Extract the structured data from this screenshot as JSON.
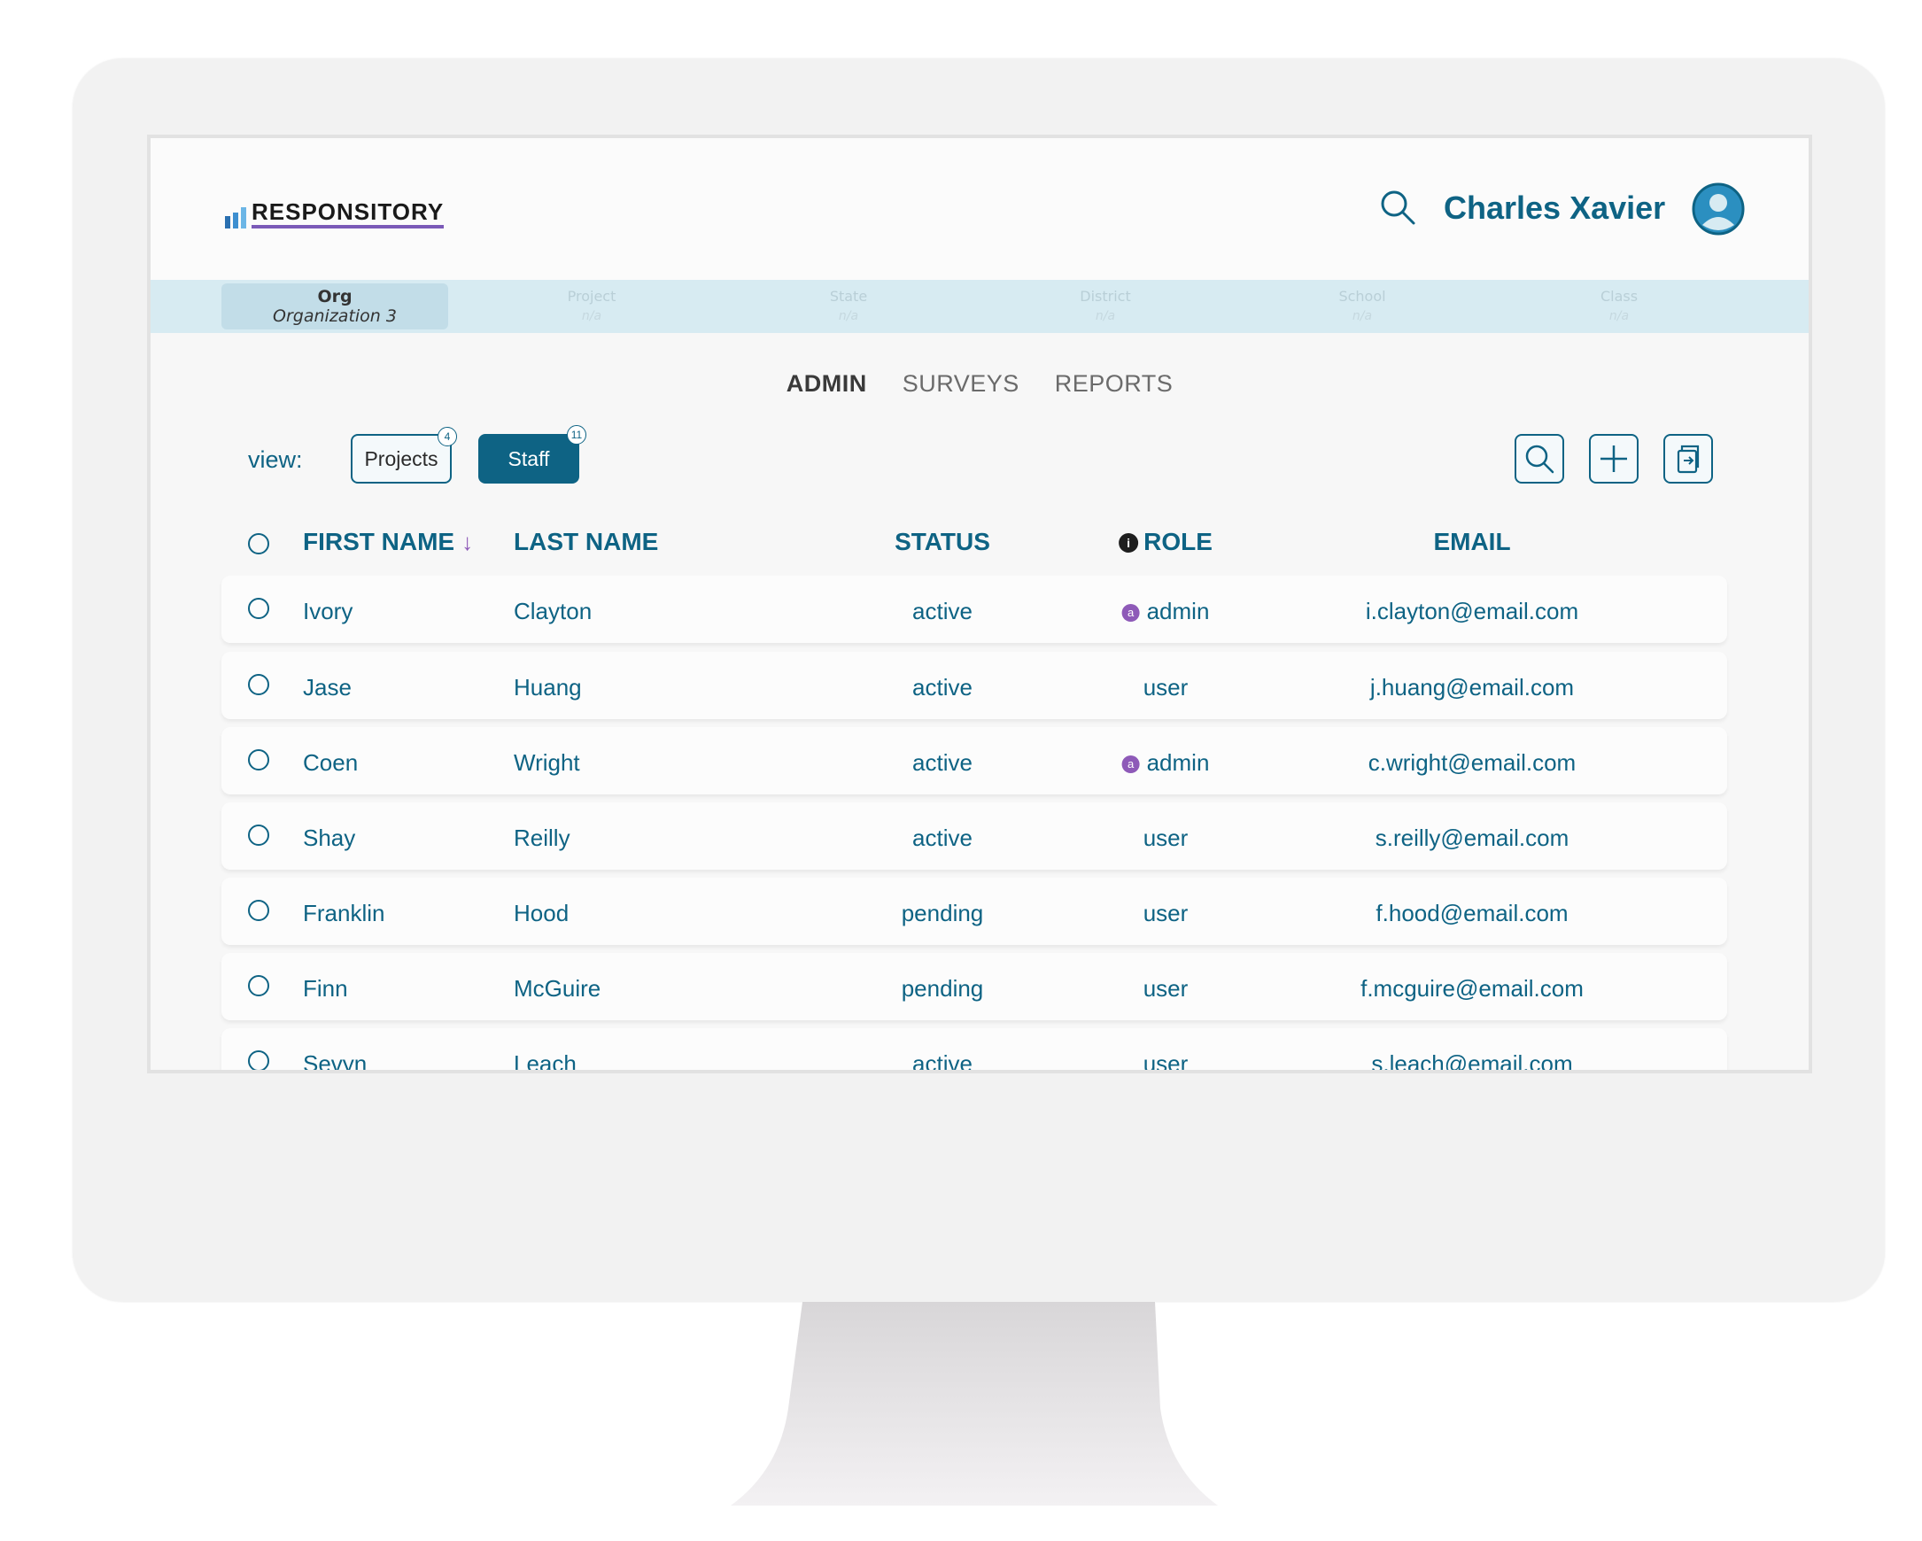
{
  "header": {
    "logo_text": "RESPONSITORY",
    "user_name": "Charles Xavier"
  },
  "breadcrumb": [
    {
      "label": "Org",
      "value": "Organization 3"
    },
    {
      "label": "Project",
      "value": "n/a"
    },
    {
      "label": "State",
      "value": "n/a"
    },
    {
      "label": "District",
      "value": "n/a"
    },
    {
      "label": "School",
      "value": "n/a"
    },
    {
      "label": "Class",
      "value": "n/a"
    }
  ],
  "nav": {
    "tabs": [
      "ADMIN",
      "SURVEYS",
      "REPORTS"
    ],
    "active": "ADMIN"
  },
  "view": {
    "label": "view:",
    "projects_label": "Projects",
    "projects_count": "4",
    "staff_label": "Staff",
    "staff_count": "11"
  },
  "table": {
    "columns": {
      "first_name": "FIRST NAME",
      "sort_arrow": "↓",
      "last_name": "LAST NAME",
      "status": "STATUS",
      "role": "ROLE",
      "role_info": "i",
      "email": "EMAIL"
    },
    "admin_badge": "a",
    "rows": [
      {
        "first": "Ivory",
        "last": "Clayton",
        "status": "active",
        "role": "admin",
        "email": "i.clayton@email.com"
      },
      {
        "first": "Jase",
        "last": "Huang",
        "status": "active",
        "role": "user",
        "email": "j.huang@email.com"
      },
      {
        "first": "Coen",
        "last": "Wright",
        "status": "active",
        "role": "admin",
        "email": "c.wright@email.com"
      },
      {
        "first": "Shay",
        "last": "Reilly",
        "status": "active",
        "role": "user",
        "email": "s.reilly@email.com"
      },
      {
        "first": "Franklin",
        "last": "Hood",
        "status": "pending",
        "role": "user",
        "email": "f.hood@email.com"
      },
      {
        "first": "Finn",
        "last": "McGuire",
        "status": "pending",
        "role": "user",
        "email": "f.mcguire@email.com"
      },
      {
        "first": "Sevyn",
        "last": "Leach",
        "status": "active",
        "role": "user",
        "email": "s.leach@email.com"
      }
    ]
  },
  "colors": {
    "primary": "#0e6384",
    "accent_purple": "#8e5ab8",
    "breadcrumb_bg": "#d7ebf2"
  }
}
